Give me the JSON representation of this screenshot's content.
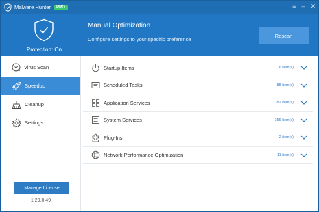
{
  "titlebar": {
    "app_name": "Malware Hunter",
    "badge": "PRO",
    "menu_icon": "≡",
    "minimize_icon": "–",
    "close_icon": "✕"
  },
  "header": {
    "protection": "Protection: On",
    "title": "Manual Optimization",
    "subtitle": "Configure settings to your specific preference",
    "rescan": "Rescan"
  },
  "sidebar": {
    "items": [
      {
        "label": "Virus Scan",
        "icon": "scan-icon",
        "active": false
      },
      {
        "label": "Speedup",
        "icon": "rocket-icon",
        "active": true
      },
      {
        "label": "Cleanup",
        "icon": "broom-icon",
        "active": false
      },
      {
        "label": "Settings",
        "icon": "gear-icon",
        "active": false
      }
    ],
    "manage_license": "Manage License",
    "version": "1.29.0.49"
  },
  "rows": [
    {
      "label": "Startup Items",
      "count": "6 item(s)",
      "icon": "power-icon"
    },
    {
      "label": "Scheduled Tasks",
      "count": "88 item(s)",
      "icon": "task-icon"
    },
    {
      "label": "Application Services",
      "count": "82 item(s)",
      "icon": "apps-icon"
    },
    {
      "label": "System Services",
      "count": "156 item(s)",
      "icon": "system-icon"
    },
    {
      "label": "Plug-Ins",
      "count": "2 item(s)",
      "icon": "plugin-icon"
    },
    {
      "label": "Network Performance Optimization",
      "count": "11 item(s)",
      "icon": "globe-icon"
    }
  ],
  "colors": {
    "primary": "#2177c3",
    "titlebar": "#1f6db3",
    "active_nav": "#3a8cd6",
    "pro_badge": "#37c871"
  }
}
